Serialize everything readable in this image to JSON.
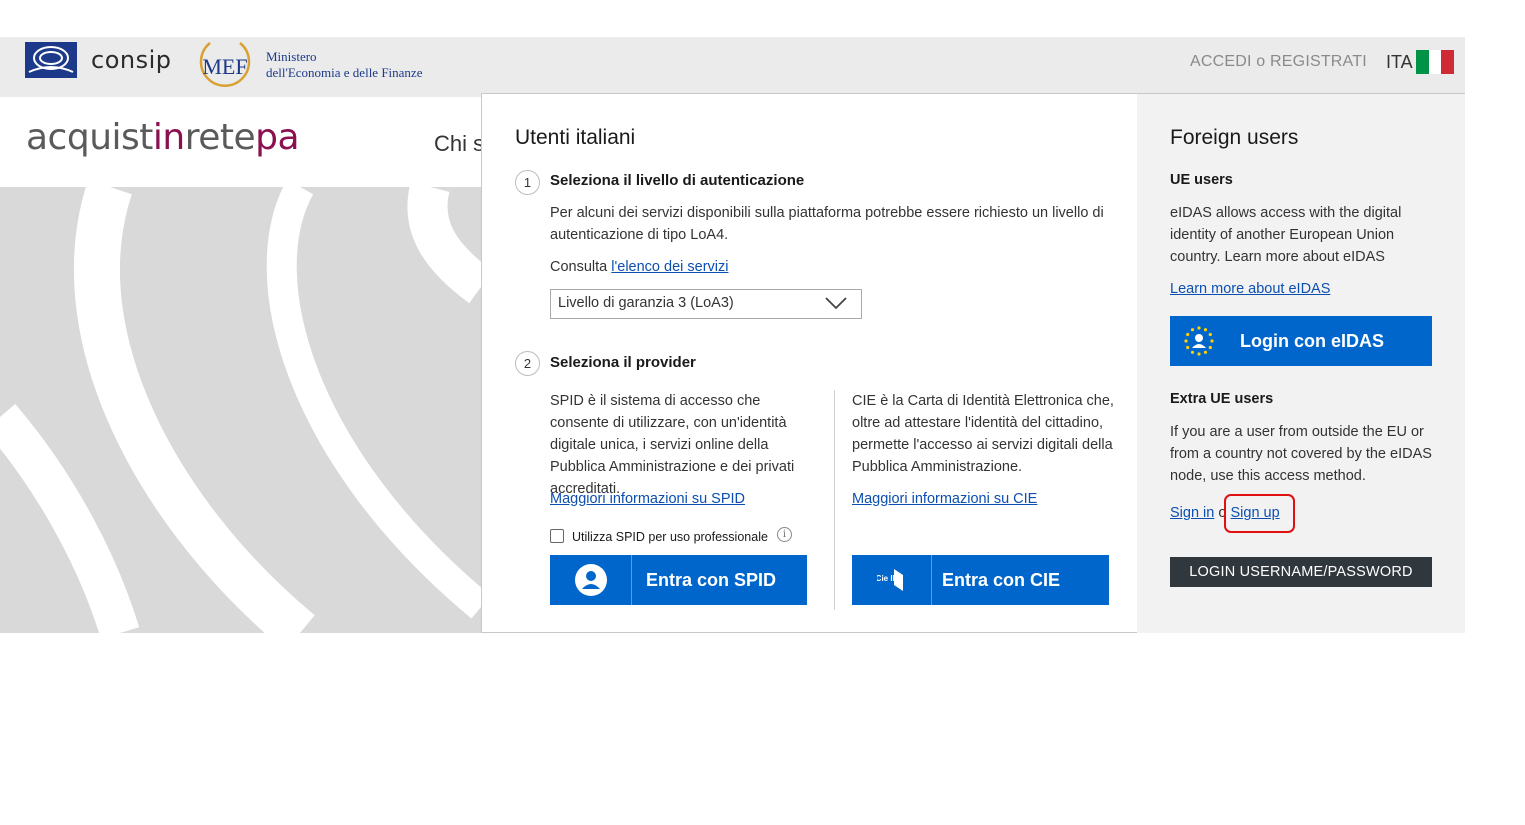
{
  "topbar": {
    "consip_label": "consip",
    "mef_abbr": "MEF",
    "mef_line1": "Ministero",
    "mef_line2": "dell'Economia e delle Finanze",
    "access_text": "ACCEDI o REGISTRATI",
    "language": "ITA",
    "flag_colors": [
      "#009246",
      "#ffffff",
      "#ce2b37"
    ]
  },
  "header": {
    "brand_parts": [
      "acquist",
      "in",
      "rete",
      "pa"
    ],
    "nav_partial": "Chi s"
  },
  "modal": {
    "italian": {
      "title": "Utenti italiani",
      "step1": {
        "number": "1",
        "title": "Seleziona il livello di autenticazione",
        "description": "Per alcuni dei servizi disponibili sulla piattaforma potrebbe essere richiesto un livello di autenticazione di tipo LoA4.",
        "consult_prefix": "Consulta ",
        "consult_link": "l'elenco dei servizi",
        "select_value": "Livello di garanzia 3 (LoA3)"
      },
      "step2": {
        "number": "2",
        "title": "Seleziona il provider",
        "spid_text": "SPID è il sistema di accesso che consente di utilizzare, con un'identità digitale unica, i servizi online della Pubblica Amministrazione e dei privati accreditati.",
        "spid_link": "Maggiori informazioni su SPID",
        "spid_checkbox_label": "Utilizza SPID per uso professionale",
        "spid_button": "Entra con SPID",
        "cie_text": "CIE è la Carta di Identità Elettronica che, oltre ad attestare l'identità del cittadino, permette l'accesso ai servizi digitali della Pubblica Amministrazione.",
        "cie_link": "Maggiori informazioni su CIE",
        "cie_icon_text": "Cie ID",
        "cie_button": "Entra con CIE"
      }
    },
    "foreign": {
      "title": "Foreign users",
      "ue_heading": "UE users",
      "ue_text": "eIDAS allows access with the digital identity of another European Union country. Learn more about eIDAS",
      "ue_link": "Learn more about eIDAS",
      "eidas_button": "Login con eIDAS",
      "extra_heading": "Extra UE users",
      "extra_text": "If you are a user from outside the EU or from a country not covered by the eIDAS node, use this access method.",
      "sign_in": "Sign in",
      "sign_or": "o",
      "sign_up": "Sign up",
      "login_button": "LOGIN USERNAME/PASSWORD"
    }
  },
  "colors": {
    "primary_blue": "#0066cc",
    "link_blue": "#0b4fb0",
    "brand_magenta": "#8a1050",
    "dark_button": "#30373d",
    "highlight_red": "#e01010"
  }
}
